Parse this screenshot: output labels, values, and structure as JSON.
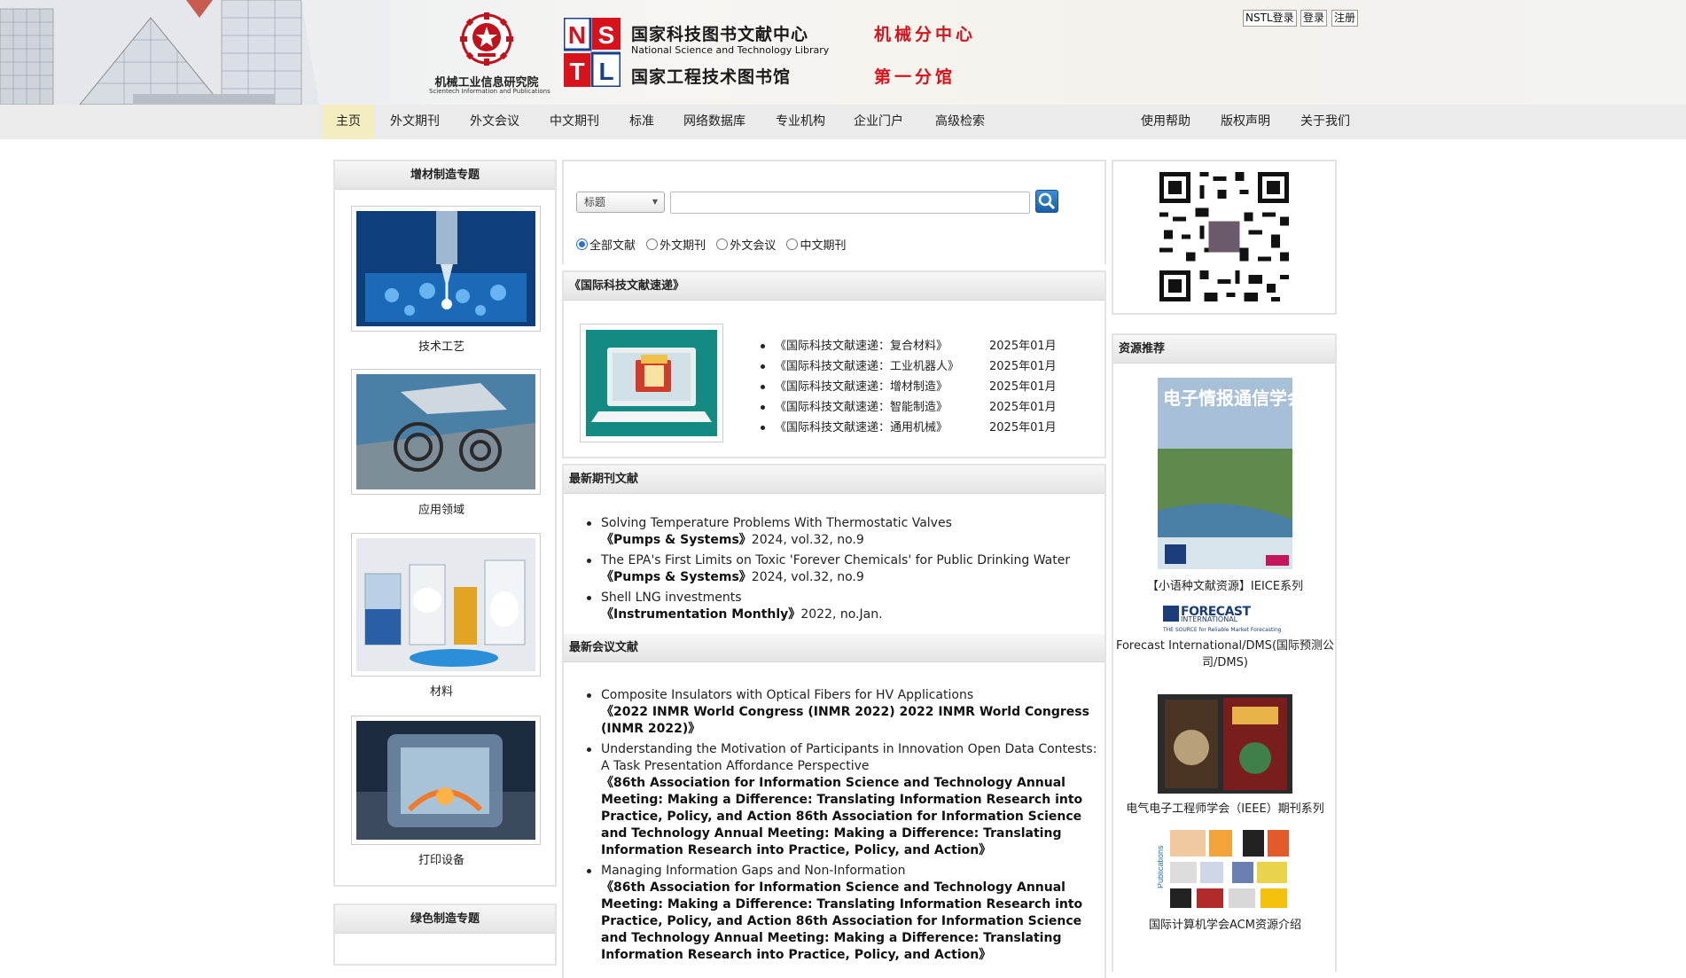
{
  "header": {
    "cmi": {
      "name": "机械工业信息研究院",
      "name_en": "Scientech Information and Publications"
    },
    "nstl": {
      "title": "国家科技图书文献中心",
      "title_en": "National Science and Technology Library",
      "subtitle": "国家工程技术图书馆",
      "mark_letters": [
        "N",
        "S",
        "T",
        "L"
      ]
    },
    "branch_1": "机械分中心",
    "branch_2": "第一分馆",
    "auth": {
      "nstl_login": "NSTL登录",
      "login": "登录",
      "register": "注册"
    },
    "colors": {
      "brand_red": "#d8121b",
      "nstl_blue": "#1a3f8c"
    }
  },
  "nav": {
    "items": [
      {
        "label": "主页",
        "active": true
      },
      {
        "label": "外文期刊"
      },
      {
        "label": "外文会议"
      },
      {
        "label": "中文期刊"
      },
      {
        "label": "标准"
      },
      {
        "label": "网络数据库"
      },
      {
        "label": "专业机构"
      },
      {
        "label": "企业门户"
      },
      {
        "label": "高级检索"
      }
    ],
    "right_items": [
      {
        "label": "使用帮助"
      },
      {
        "label": "版权声明"
      },
      {
        "label": "关于我们"
      }
    ]
  },
  "left": {
    "panel1_title": "增材制造专题",
    "topics": [
      {
        "caption": "技术工艺"
      },
      {
        "caption": "应用领域"
      },
      {
        "caption": "材料"
      },
      {
        "caption": "打印设备"
      }
    ],
    "panel2_title": "绿色制造专题"
  },
  "search": {
    "type_selected": "标题",
    "input_value": "",
    "button_icon": "search-icon",
    "scopes": [
      {
        "label": "全部文献",
        "checked": true
      },
      {
        "label": "外文期刊",
        "checked": false
      },
      {
        "label": "外文会议",
        "checked": false
      },
      {
        "label": "中文期刊",
        "checked": false
      }
    ]
  },
  "digest": {
    "title": "《国际科技文献速递》",
    "image_icon": "laptop-folder-icon",
    "items": [
      {
        "title": "《国际科技文献速递：复合材料》",
        "date": "2025年01月"
      },
      {
        "title": "《国际科技文献速递：工业机器人》",
        "date": "2025年01月"
      },
      {
        "title": "《国际科技文献速递：增材制造》",
        "date": "2025年01月"
      },
      {
        "title": "《国际科技文献速递：智能制造》",
        "date": "2025年01月"
      },
      {
        "title": "《国际科技文献速递：通用机械》",
        "date": "2025年01月"
      }
    ]
  },
  "journals": {
    "title": "最新期刊文献",
    "items": [
      {
        "title": "Solving Temperature Problems With Thermostatic Valves",
        "source": "《Pumps & Systems》",
        "meta": "2024, vol.32, no.9"
      },
      {
        "title": "The EPA's First Limits on Toxic 'Forever Chemicals' for Public Drinking Water",
        "source": "《Pumps & Systems》",
        "meta": "2024, vol.32, no.9"
      },
      {
        "title": "Shell LNG investments",
        "source": "《Instrumentation Monthly》",
        "meta": "2022, no.Jan."
      }
    ]
  },
  "conferences": {
    "title": "最新会议文献",
    "items": [
      {
        "title": "Composite Insulators with Optical Fibers for HV Applications",
        "source": "《2022 INMR World Congress (INMR 2022) 2022 INMR World Congress (INMR 2022)》"
      },
      {
        "title": "Understanding the Motivation of Participants in Innovation Open Data Contests: A Task Presentation Affordance Perspective",
        "source": "《86th Association for Information Science and Technology Annual Meeting: Making a Difference: Translating Information Research into Practice, Policy, and Action 86th Association for Information Science and Technology Annual Meeting: Making a Difference: Translating Information Research into Practice, Policy, and Action》"
      },
      {
        "title": "Managing Information Gaps and Non-Information",
        "source": "《86th Association for Information Science and Technology Annual Meeting: Making a Difference: Translating Information Research into Practice, Policy, and Action 86th Association for Information Science and Technology Annual Meeting: Making a Difference: Translating Information Research into Practice, Policy, and Action》"
      }
    ]
  },
  "right": {
    "qr_icon": "qr-code-icon",
    "resources_title": "资源推荐",
    "magazine_title": "电子情报通信学会誌",
    "resources": [
      {
        "caption": "【小语种文献资源】IEICE系列"
      },
      {
        "caption": "Forecast International/DMS(国际预测公司/DMS)",
        "logo_text": "FORECAST",
        "logo_sub": "INTERNATIONAL",
        "logo_tag": "THE SOURCE for Reliable Market Forecasting"
      },
      {
        "caption": "电气电子工程师学会（IEEE）期刊系列"
      },
      {
        "caption": "国际计算机学会ACM资源介绍",
        "side_label": "Publications"
      }
    ]
  }
}
